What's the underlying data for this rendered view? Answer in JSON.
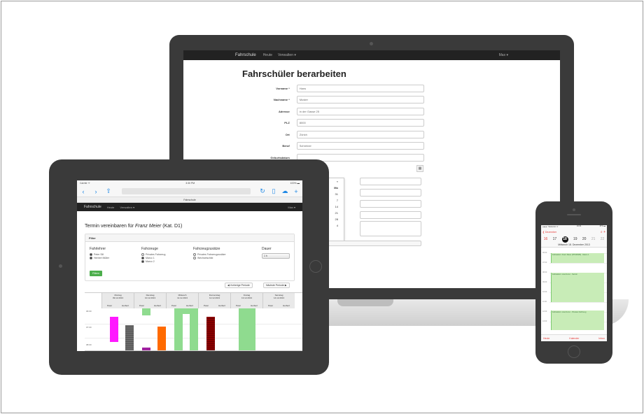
{
  "laptop": {
    "nav": {
      "brand": "Fahrschule",
      "items": [
        "Heute",
        "Verwalten ▾"
      ],
      "user": "Max ▾"
    },
    "page_title": "Fahrschüler berarbeiten",
    "fields": [
      {
        "label": "Vorname *",
        "value": "Hans"
      },
      {
        "label": "Nachname *",
        "value": "Muster"
      },
      {
        "label": "Adresse",
        "value": "in der Gasse 25"
      },
      {
        "label": "PLZ",
        "value": "8000"
      },
      {
        "label": "Ort",
        "value": "Zürich"
      },
      {
        "label": "Beruf",
        "value": "Schreiner"
      },
      {
        "label": "Geburtsdatum",
        "value": ""
      }
    ],
    "calendar_icon": "calendar-icon",
    "dropdown_items": [
      "«",
      "Mo",
      "31",
      "7",
      "14",
      "21",
      "28",
      "4"
    ]
  },
  "tablet": {
    "status": {
      "carrier": "Carrier ᯤ",
      "time": "3:30 PM",
      "battery": "100% ▬"
    },
    "tab_title": "Fahrschule",
    "nav": {
      "brand": "Fahrschule",
      "items": [
        "Heute",
        "Verwalten ▾"
      ],
      "user": "Max ▾"
    },
    "title_prefix": "Termin vereinbaren für ",
    "title_name": "Franz Meier",
    "title_suffix": " (Kat. D1)",
    "filter": {
      "heading": "Filter",
      "columns": [
        {
          "heading": "Fahrlehrer",
          "options": [
            {
              "label": "Peter Sill",
              "checked": true
            },
            {
              "label": "Herbert Müller",
              "checked": true
            }
          ]
        },
        {
          "heading": "Fahrzeuge",
          "options": [
            {
              "label": "Privates Fahrzeug",
              "checked": false
            },
            {
              "label": "Marco 1",
              "checked": true
            },
            {
              "label": "Marco 2",
              "checked": true
            }
          ]
        },
        {
          "heading": "Fahrzeugzusätze",
          "options": [
            {
              "label": "Privates Fahrzeugzusätze",
              "checked": false
            },
            {
              "label": "Wechselschild",
              "checked": false
            }
          ]
        },
        {
          "heading": "Dauer",
          "options": []
        }
      ],
      "dauer_value": "1 h",
      "button": "Filtern"
    },
    "prev_period": "◀ Vorherige Periode",
    "next_period": "Nächste Periode ▶",
    "days": [
      {
        "name": "Montag",
        "date": "09.12.2013"
      },
      {
        "name": "Dienstag",
        "date": "10.12.2013"
      },
      {
        "name": "Mittwoch",
        "date": "11.12.2013"
      },
      {
        "name": "Donnerstag",
        "date": "12.12.2013"
      },
      {
        "name": "Freitag",
        "date": "13.12.2013"
      },
      {
        "name": "Samstag",
        "date": "14.12.2013"
      }
    ],
    "sub_cols": [
      "Peter",
      "Herbert"
    ],
    "times": [
      "06:00",
      "07:00",
      "08:00"
    ],
    "colors": {
      "magenta": "#ff1aff",
      "grey": "#6b6b6b",
      "green": "#8fdb8f",
      "orange": "#ff6a00",
      "maroon": "#8b0000",
      "purple": "#a020a0"
    }
  },
  "phone": {
    "status": {
      "carrier": "●●●●○ Swisscom ᯤ",
      "time": "16:31",
      "battery": "87% ▬"
    },
    "back": "❮ Dezember",
    "icons": "⌕  +",
    "weekdays": [
      "M",
      "D",
      "M",
      "D",
      "F",
      "S",
      "S"
    ],
    "days": [
      "16",
      "17",
      "18",
      "19",
      "20",
      "21",
      "22"
    ],
    "selected_index": 2,
    "date_line": "Mittwoch  18. Dezember 2013",
    "times": [
      "06:00",
      "07:00",
      "08:00",
      "09:00",
      "10:00",
      "11:00",
      "12:00",
      "13:00"
    ],
    "events": [
      "Fahrlektion: Franz Meier (ZH345465) - Marco 1",
      "Fahrlektion: Lisa Furrer - Suzuki",
      "Fahrlektion: Lisa Furrer - Privates Fahrzeug"
    ],
    "footer": [
      "Heute",
      "Kalender",
      "Inbox"
    ]
  }
}
